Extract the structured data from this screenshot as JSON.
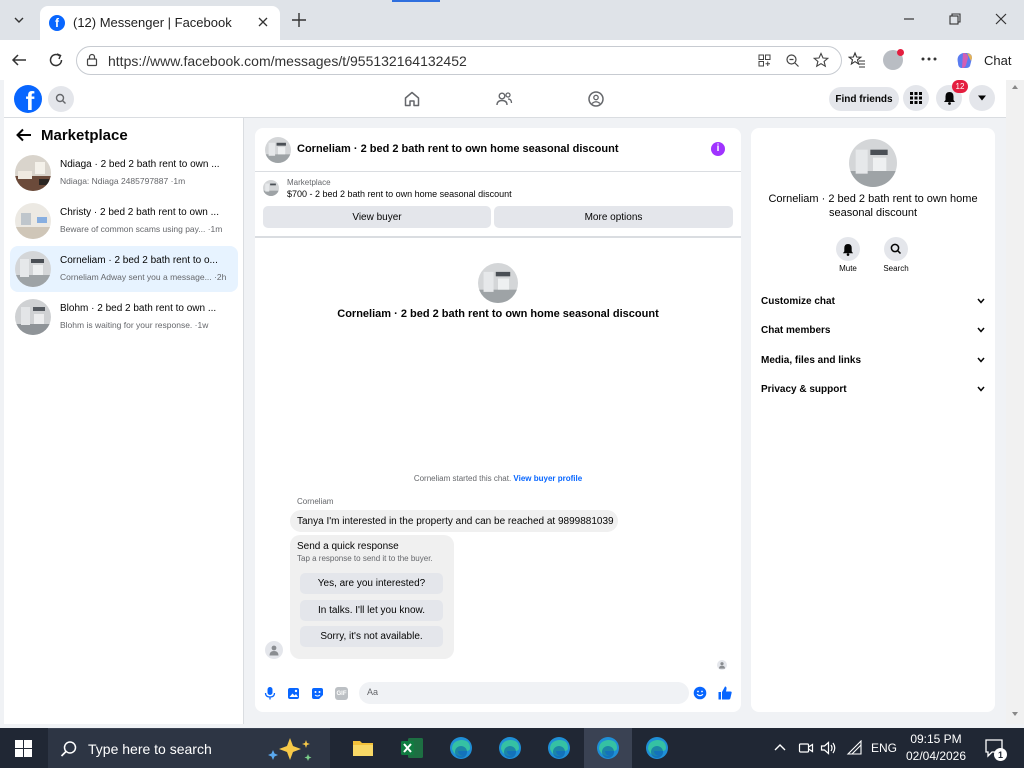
{
  "browser": {
    "tab_title": "(12) Messenger | Facebook",
    "url": "https://www.facebook.com/messages/t/955132164132452",
    "copilot_label": "Chat"
  },
  "header": {
    "find_friends": "Find friends",
    "notification_count": "12"
  },
  "sidebar": {
    "title": "Marketplace",
    "conversations": [
      {
        "title": "Ndiaga · 2 bed 2 bath rent to own ...",
        "subtitle": "Ndiaga: Ndiaga 2485797887 ·1m"
      },
      {
        "title": "Christy · 2 bed 2 bath rent to own ...",
        "subtitle": "Beware of common scams using pay... ·1m"
      },
      {
        "title": "Corneliam · 2 bed 2 bath rent to o...",
        "subtitle": "Corneliam Adway sent you a message... ·2h"
      },
      {
        "title": "Blohm · 2 bed 2 bath rent to own ...",
        "subtitle": "Blohm is waiting for your response. ·1w"
      }
    ]
  },
  "chat": {
    "header_title": "Corneliam · 2 bed 2 bath rent to own home seasonal discount",
    "listing_label": "Marketplace",
    "listing_detail": "$700 - 2 bed 2 bath rent to own home seasonal discount",
    "view_buyer": "View buyer",
    "more_options": "More options",
    "center_title": "Corneliam · 2 bed 2 bath rent to own home seasonal discount",
    "started_text": "Corneliam started this chat.",
    "view_profile": "View buyer profile",
    "sender_name": "Corneliam",
    "message": "Tanya I'm interested in the property and can be reached at 9899881039",
    "quick_title": "Send a quick response",
    "quick_sub": "Tap a response to send it to the buyer.",
    "quick_options": [
      "Yes, are you interested?",
      "In talks. I'll let you know.",
      "Sorry, it's not available."
    ],
    "input_placeholder": "Aa"
  },
  "details": {
    "title": "Corneliam · 2 bed 2 bath rent to own home seasonal discount",
    "mute": "Mute",
    "search": "Search",
    "menu": [
      "Customize chat",
      "Chat members",
      "Media, files and links",
      "Privacy & support"
    ]
  },
  "taskbar": {
    "search_placeholder": "Type here to search",
    "language": "ENG",
    "time": "09:15 PM",
    "date": "02/04/2026",
    "notif_count": "1"
  },
  "colors": {
    "fb_blue": "#0866ff",
    "active_conv": "#e7f3ff",
    "info_purple": "#a033ff",
    "badge_red": "#e41e3f"
  }
}
